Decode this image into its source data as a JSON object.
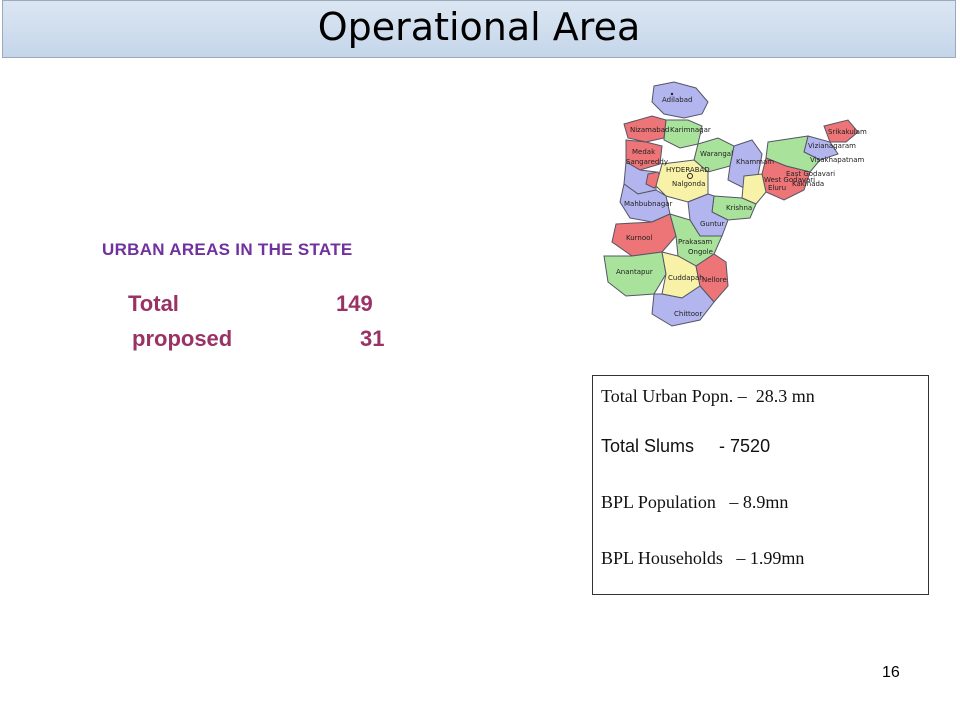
{
  "slide": {
    "title": "Operational Area",
    "heading": "URBAN AREAS IN THE STATE",
    "total_label": "Total",
    "total_value": "149",
    "proposed_label": "proposed",
    "proposed_value": "31",
    "page_number": "16"
  },
  "stats_box": {
    "line1": "Total Urban Popn. –  28.3 mn",
    "line2": "Total Slums     - 7520",
    "line3": "BPL Population   – 8.9mn",
    "line4": "BPL Households   – 1.99mn"
  },
  "map": {
    "districts": [
      "Adilabad",
      "Nizamabad",
      "Karimnagar",
      "Medak",
      "Warangal",
      "Sangareddy",
      "HYDERABAD",
      "Khammam",
      "Nalgonda",
      "Mahbubnagar",
      "West Godavari",
      "East Godavari",
      "Krishna",
      "Guntur",
      "Srikakulam",
      "Vizianagaram",
      "Visakhapatnam",
      "Kurnool",
      "Prakasam",
      "Ongole",
      "Anantapur",
      "Cuddapah",
      "Nellore",
      "Chittoor",
      "Eluru",
      "Kakinada"
    ],
    "colors": {
      "lavender": "#b3b5ee",
      "pink": "#ee7577",
      "green": "#a9e29a",
      "yellow": "#f7f2a8",
      "border": "#555566"
    }
  }
}
